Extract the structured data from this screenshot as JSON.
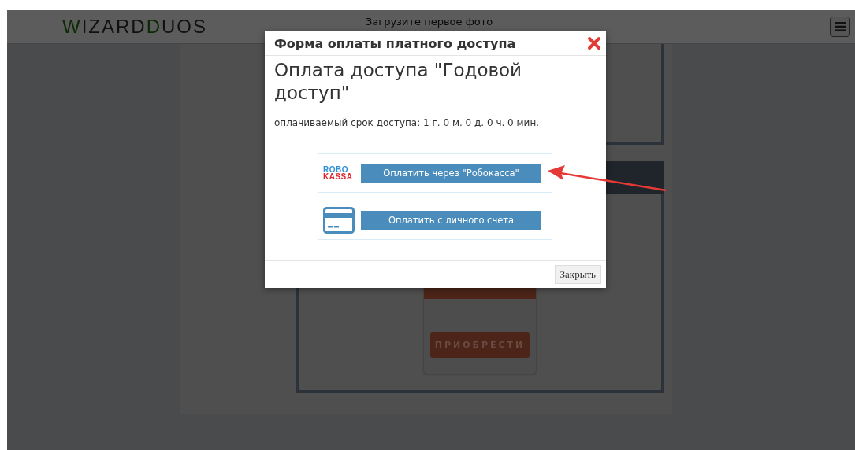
{
  "header": {
    "logo": [
      {
        "text": "W",
        "accent": true
      },
      {
        "text": "IZARD",
        "accent": false
      },
      {
        "text": "D",
        "accent": true
      },
      {
        "text": "UOS",
        "accent": false
      }
    ],
    "title": "Загрузите первое фото"
  },
  "background_card": {
    "button": "ПРИОБРЕСТИ"
  },
  "modal": {
    "title": "Форма оплаты платного доступа",
    "heading": "Оплата доступа \"Годовой доступ\"",
    "period": "оплачиваемый срок доступа: 1 г. 0 м. 0 д. 0 ч. 0 мин.",
    "options": [
      {
        "kind": "robokassa",
        "logo_top": "ROBO",
        "logo_bottom": "KASSA",
        "button": "Оплатить через \"Робокасса\""
      },
      {
        "kind": "card",
        "button": "Оплатить с личного счета"
      }
    ],
    "close_button": "Закрыть"
  }
}
